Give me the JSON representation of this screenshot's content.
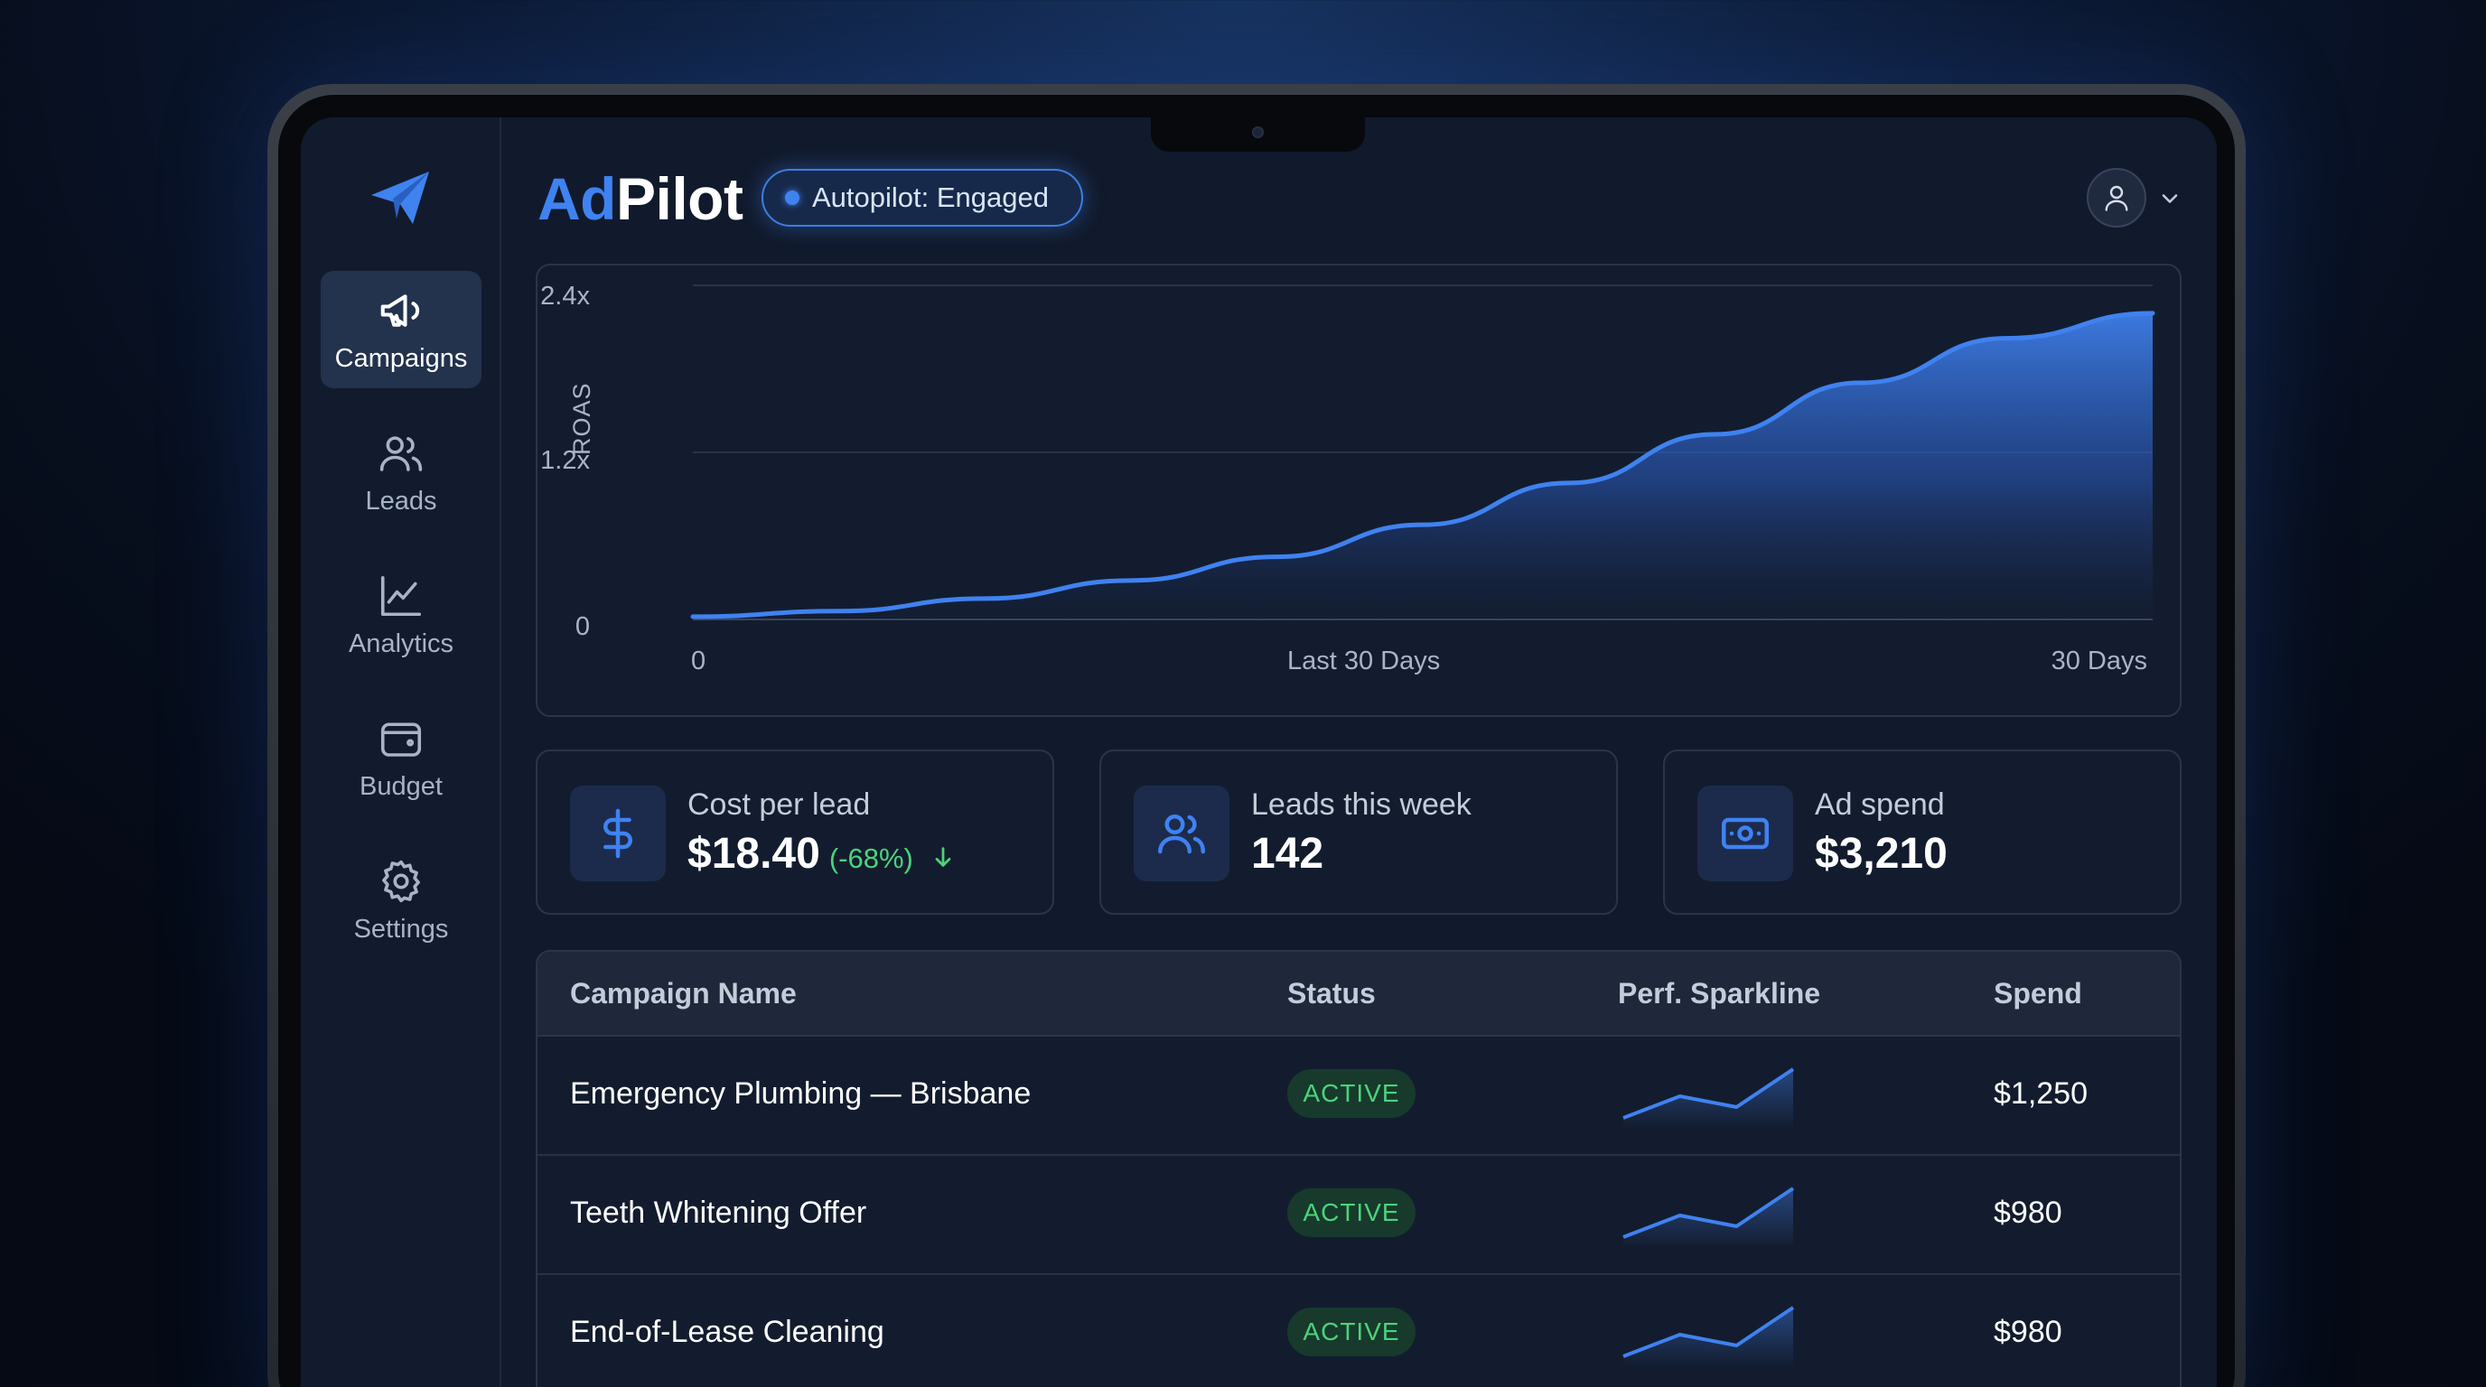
{
  "app": {
    "brand_part1": "Ad",
    "brand_part2": "Pilot",
    "status_pill": "Autopilot: Engaged"
  },
  "sidebar": {
    "items": [
      {
        "label": "Campaigns",
        "icon": "megaphone-icon",
        "active": true
      },
      {
        "label": "Leads",
        "icon": "users-icon",
        "active": false
      },
      {
        "label": "Analytics",
        "icon": "line-chart-icon",
        "active": false
      },
      {
        "label": "Budget",
        "icon": "wallet-icon",
        "active": false
      },
      {
        "label": "Settings",
        "icon": "gear-icon",
        "active": false
      }
    ]
  },
  "chart_data": {
    "type": "area",
    "ylabel": "ROAS",
    "xlabel": "Last 30 Days",
    "x_ticks": [
      "0",
      "30 Days"
    ],
    "y_ticks": [
      "0",
      "1.2x",
      "2.4x"
    ],
    "ylim": [
      0,
      2.4
    ],
    "xlim": [
      0,
      30
    ],
    "grid": true,
    "series": [
      {
        "x": [
          0,
          3,
          6,
          9,
          12,
          15,
          18,
          21,
          24,
          27,
          30
        ],
        "values": [
          0.02,
          0.06,
          0.15,
          0.28,
          0.45,
          0.68,
          0.98,
          1.33,
          1.7,
          2.02,
          2.2
        ]
      }
    ]
  },
  "kpis": [
    {
      "label": "Cost per lead",
      "value": "$18.40",
      "change": "(-68%)",
      "icon": "dollar-icon"
    },
    {
      "label": "Leads this week",
      "value": "142",
      "icon": "users-icon"
    },
    {
      "label": "Ad spend",
      "value": "$3,210",
      "icon": "banknote-icon"
    }
  ],
  "table": {
    "columns": [
      "Campaign Name",
      "Status",
      "Perf. Sparkline",
      "Spend"
    ],
    "rows": [
      {
        "name": "Emergency Plumbing — Brisbane",
        "status": "ACTIVE",
        "spend": "$1,250",
        "spark": [
          0.1,
          0.5,
          0.3,
          1.0
        ]
      },
      {
        "name": "Teeth Whitening Offer",
        "status": "ACTIVE",
        "spend": "$980",
        "spark": [
          0.1,
          0.5,
          0.3,
          1.0
        ]
      },
      {
        "name": "End-of-Lease Cleaning",
        "status": "ACTIVE",
        "spend": "$980",
        "spark": [
          0.1,
          0.5,
          0.3,
          1.0
        ]
      }
    ]
  },
  "colors": {
    "accent": "#3f82f0",
    "success": "#4cd37a",
    "background": "#111a2c"
  }
}
